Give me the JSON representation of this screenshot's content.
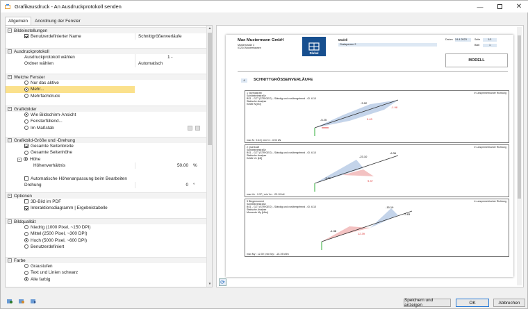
{
  "window": {
    "title": "Grafikausdruck - An Ausdruckprotokoll senden"
  },
  "tabs": [
    "Allgemein",
    "Anordnung der Fenster"
  ],
  "sections": {
    "bild": {
      "title": "Bildeinstellungen",
      "custom_name_label": "Benutzerdefinierter Name",
      "custom_name_value": "Schnittgrößenverläufe"
    },
    "protokoll": {
      "title": "Ausdruckprotokoll",
      "choose_label": "Ausdruckprotokoll wählen",
      "choose_value": "1 -",
      "folder_label": "Ordner wählen",
      "folder_value": "Automatisch"
    },
    "fenster": {
      "title": "Welche Fenster",
      "opt1": "Nur das aktive",
      "opt2": "Mehr...",
      "opt3": "Mehrfachdruck"
    },
    "grafik": {
      "title": "Grafikbilder",
      "opt1": "Wie Bildschirm-Ansicht",
      "opt2": "Fensterfüllend...",
      "opt3": "Im Maßstab"
    },
    "groesse": {
      "title": "Grafikbild-Größe und -Drehung",
      "opt1": "Gesamte Seitenbreite",
      "opt2": "Gesamte Seitenhöhe",
      "opt3": "Höhe",
      "ratio_label": "Höhenverhältnis",
      "ratio_value": "50.00",
      "ratio_unit": "%",
      "auto_label": "Automatische Höhenanpassung beim Bearbeiten",
      "rot_label": "Drehung",
      "rot_value": "0",
      "rot_unit": "°"
    },
    "optionen": {
      "title": "Optionen",
      "opt1": "3D-Bild im PDF",
      "opt2": "Interaktionsdiagramm | Ergebnistabelle"
    },
    "qualitaet": {
      "title": "Bildqualität",
      "opt1": "Niedrig (1000 Pixel, ~150 DPI)",
      "opt2": "Mittel (2500 Pixel, ~300 DPI)",
      "opt3": "Hoch (5000 Pixel, ~600 DPI)",
      "opt4": "Benutzerdefiniert"
    },
    "farbe": {
      "title": "Farbe",
      "opt1": "Graustufen",
      "opt2": "Text und Linien schwarz",
      "opt3": "Alle farbig"
    }
  },
  "preview": {
    "company": "Max Mustermann GmbH",
    "street": "Musterstraße 3",
    "city": "01234 Musterhausen",
    "logo": "Dlubal",
    "model_label": "Modell",
    "model_value": "Gratsparren 2",
    "date_label": "Datum",
    "date_value": "24.4.2023",
    "page_label": "Seite",
    "page_value": "1/1",
    "sheet_label": "Blatt",
    "sheet_value": "1",
    "modell_box": "MODELL",
    "section_no": "4",
    "section_title": "SCHNITTGRÖSSENVERLÄUFE",
    "diagrams": [
      {
        "title": "1 Normalkraft",
        "l2": "Schiltebelestraße",
        "l3": "BS1 - GZT (STR/GEO) - Ständig und vorübergehend - Gl. 6.10",
        "l4": "Statische Analyse",
        "l5": "Kräfte N [kN]",
        "right": "In unsymmetrischer Richtung",
        "foot": "max N : 9.43 | min N : -3.92 kN",
        "labels": [
          "-3.92",
          "-5.25",
          "-1.98",
          "9.43"
        ]
      },
      {
        "title": "2 Querkraft",
        "l2": "Schiltebelestraße",
        "l3": "BS1 - GZT (STR/GEO) - Ständig und vorübergehend - Gl. 6.10",
        "l4": "Statische Analyse",
        "l5": "Kräfte Vz [kN]",
        "right": "In unsymmetrischer Richtung",
        "foot": "max Vz : 9.37 | min Vz : -23.10 kN",
        "labels": [
          "-23.10",
          "-6.36",
          "-3.02",
          "9.37"
        ]
      },
      {
        "title": "3 Biegemoment",
        "l2": "Schiltebelestraße",
        "l3": "BS1 - GZT (STR/GEO) - Ständig und vorübergehend - Gl. 6.10",
        "l4": "Statische Analyse",
        "l5": "Momente My [kNm]",
        "right": "In unsymmetrischer Richtung",
        "foot": "max My : 12.39 | min My : -15.19 kNm",
        "labels": [
          "-15.19",
          "-1.38",
          "12.39",
          "-2.83"
        ]
      }
    ]
  },
  "buttons": {
    "save": "Speichern und anzeigen",
    "ok": "OK",
    "cancel": "Abbrechen"
  }
}
